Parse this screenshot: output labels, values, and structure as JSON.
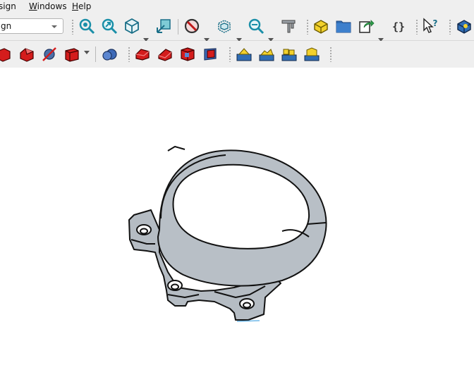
{
  "menu": {
    "design_visible": "sign",
    "windows_m": "W",
    "windows_rest": "indows",
    "help_m": "H",
    "help_rest": "elp"
  },
  "workbench": {
    "selected": "gn"
  },
  "toolbar1_icons": [
    "fit-all-icon",
    "fit-selection-icon",
    "isometric-view-icon",
    "sync-view-icon",
    "no-selection-icon",
    "bounding-box-icon",
    "zoom-icon",
    "measure-icon",
    "part-icon",
    "folder-icon",
    "export-icon",
    "macro-icon",
    "whats-this-icon",
    "body-icon"
  ],
  "toolbar2_icons": [
    "red-shape-icon",
    "red-chamfer-icon",
    "red-cut-icon",
    "red-box-icon",
    "blue-sphere-icon",
    "red-wedge-1-icon",
    "red-wedge-2-icon",
    "red-cube-icon",
    "red-prism-icon",
    "yellow-mesh-1-icon",
    "yellow-mesh-2-icon",
    "yellow-mesh-3-icon",
    "yellow-mesh-4-icon"
  ],
  "colors": {
    "part_fill": "#b5bcc3",
    "part_stroke": "#111111",
    "toolbar_bg": "#efefef"
  }
}
